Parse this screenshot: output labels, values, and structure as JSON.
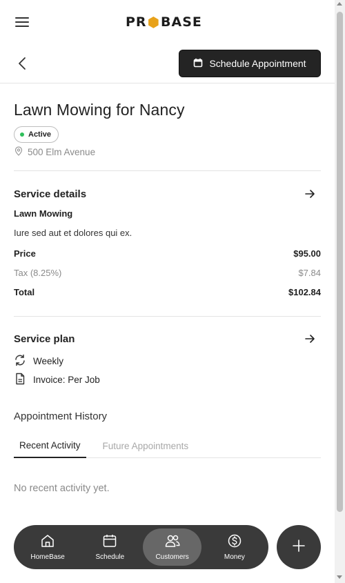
{
  "header": {
    "logo_text_left": "PR",
    "logo_text_right": "BASE",
    "menu_icon": "menu-icon"
  },
  "subbar": {
    "back_icon": "chevron-left-icon",
    "schedule_button": "Schedule Appointment"
  },
  "job": {
    "title": "Lawn Mowing for Nancy",
    "status": "Active",
    "status_color": "#2fbf5b",
    "address": "500 Elm Avenue"
  },
  "service_details": {
    "heading": "Service details",
    "name": "Lawn Mowing",
    "description": "Iure sed aut et dolores qui ex.",
    "price_label": "Price",
    "price_value": "$95.00",
    "tax_label": "Tax (8.25%)",
    "tax_value": "$7.84",
    "total_label": "Total",
    "total_value": "$102.84"
  },
  "service_plan": {
    "heading": "Service plan",
    "frequency": "Weekly",
    "invoice": "Invoice: Per Job"
  },
  "history": {
    "heading": "Appointment History",
    "tabs": [
      "Recent Activity",
      "Future Appointments"
    ],
    "active_tab": "Recent Activity",
    "empty_message": "No recent activity yet."
  },
  "bottom_nav": {
    "items": [
      {
        "label": "HomeBase",
        "icon": "home-icon"
      },
      {
        "label": "Schedule",
        "icon": "calendar-icon"
      },
      {
        "label": "Customers",
        "icon": "users-icon"
      },
      {
        "label": "Money",
        "icon": "dollar-icon"
      }
    ],
    "active": "Customers",
    "fab_icon": "plus-icon"
  }
}
